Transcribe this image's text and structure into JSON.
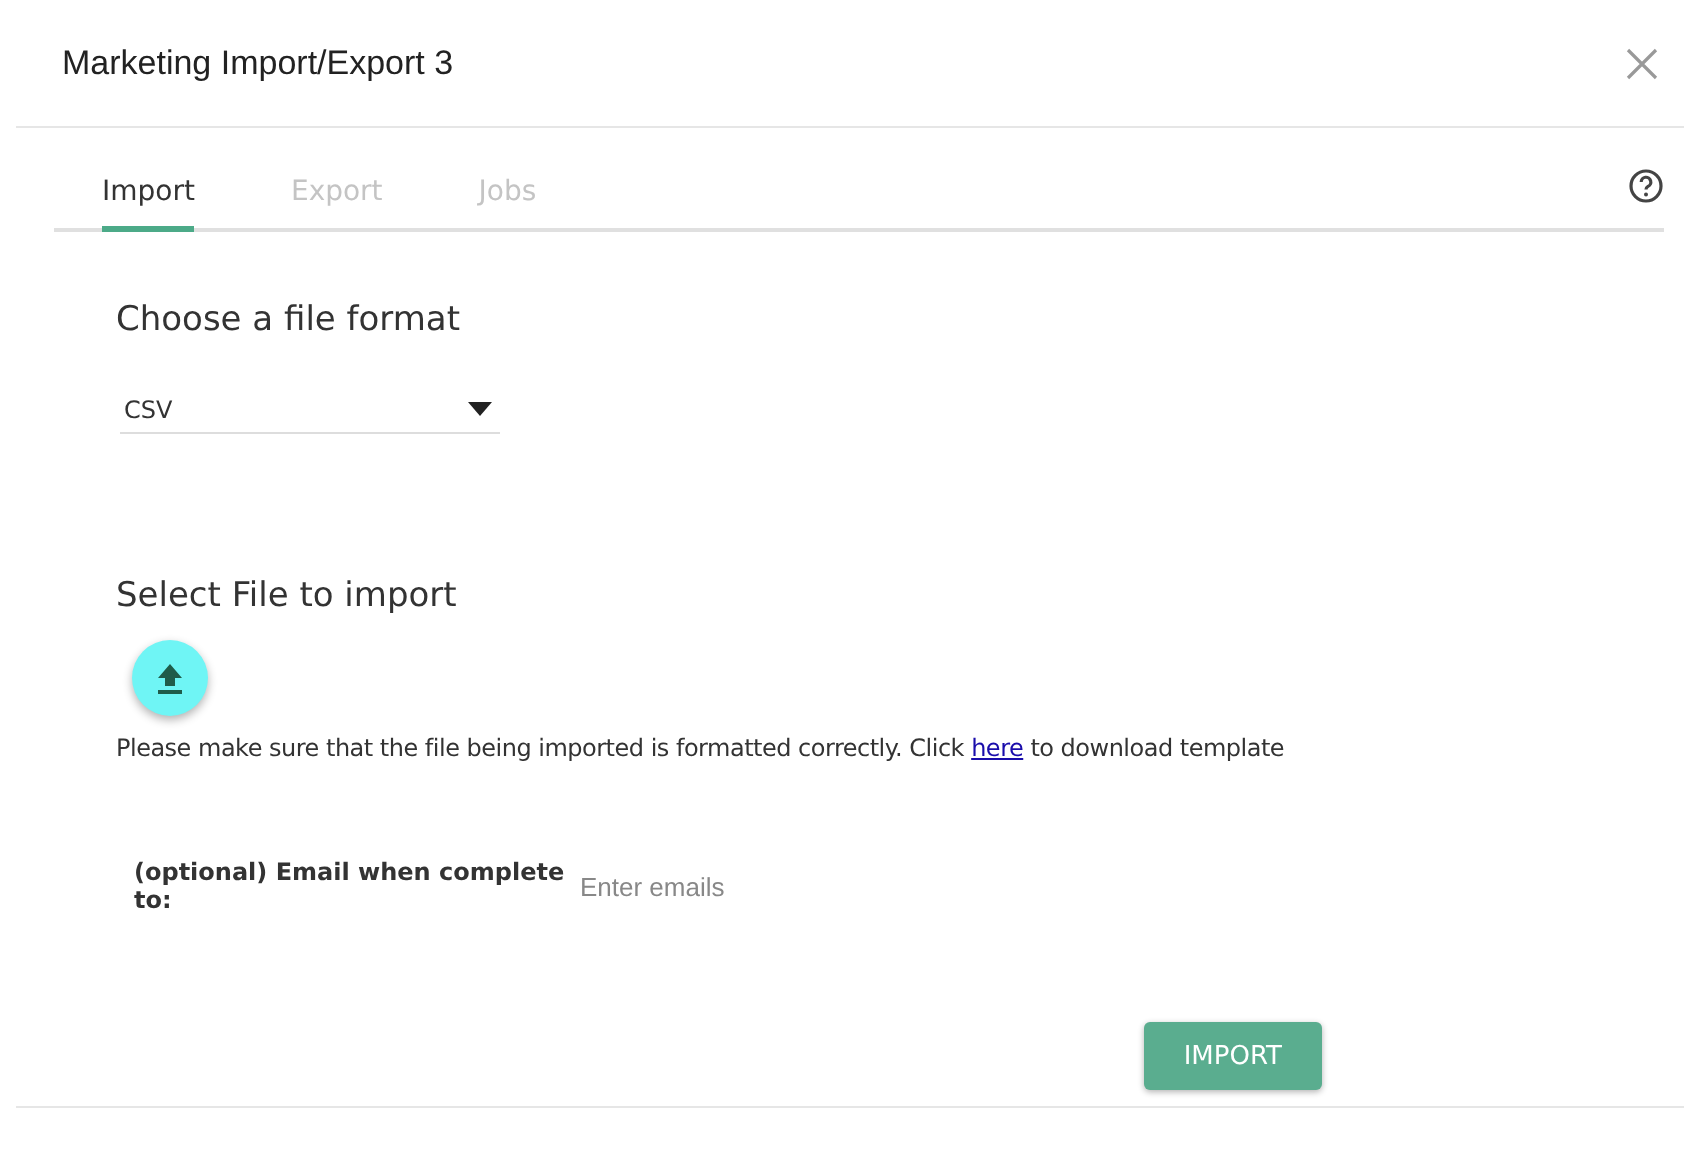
{
  "window": {
    "title": "Marketing Import/Export 3"
  },
  "tabs": [
    {
      "label": "Import",
      "selected": true
    },
    {
      "label": "Export",
      "selected": false
    },
    {
      "label": "Jobs",
      "selected": false
    }
  ],
  "format_section": {
    "heading": "Choose a file format",
    "select": {
      "value": "CSV"
    }
  },
  "file_section": {
    "heading": "Select File to import",
    "note": {
      "before": "Please make sure that the file being imported is formatted correctly. Click ",
      "link": "here",
      "after": " to download template"
    }
  },
  "email": {
    "label": "(optional) Email when complete to:",
    "placeholder": "Enter emails"
  },
  "buttons": [
    {
      "label": "IMPORT"
    }
  ]
}
